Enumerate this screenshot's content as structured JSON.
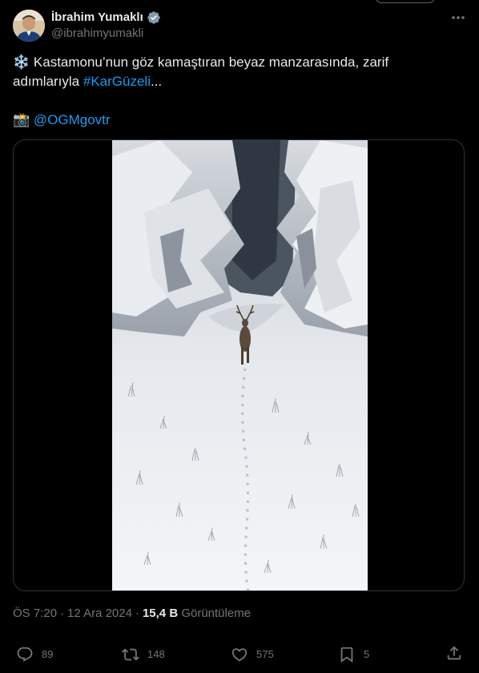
{
  "author": {
    "display_name": "İbrahim Yumaklı",
    "handle": "@ibrahimyumakli",
    "verified": true
  },
  "tweet": {
    "line1_emoji": "❄️",
    "line1_text": " Kastamonu’nun göz kamaştıran beyaz manzarasında, zarif",
    "line2_text": "adımlarıyla ",
    "line2_hashtag": "#KarGüzeli",
    "line2_ellipsis": "...",
    "credit_emoji": "📸",
    "credit_mention": "@OGMgovtr"
  },
  "meta": {
    "time": "ÖS 7:20",
    "separator": "·",
    "date": "12 Ara 2024",
    "separator2": "·",
    "views_count": "15,4 B",
    "views_label": "Görüntüleme"
  },
  "actions": {
    "replies": "89",
    "reposts": "148",
    "likes": "575",
    "bookmarks": "5"
  },
  "colors": {
    "background": "#000000",
    "text": "#e7e9ea",
    "secondary": "#71767b",
    "link": "#1d9bf0",
    "border": "#2f3336"
  }
}
